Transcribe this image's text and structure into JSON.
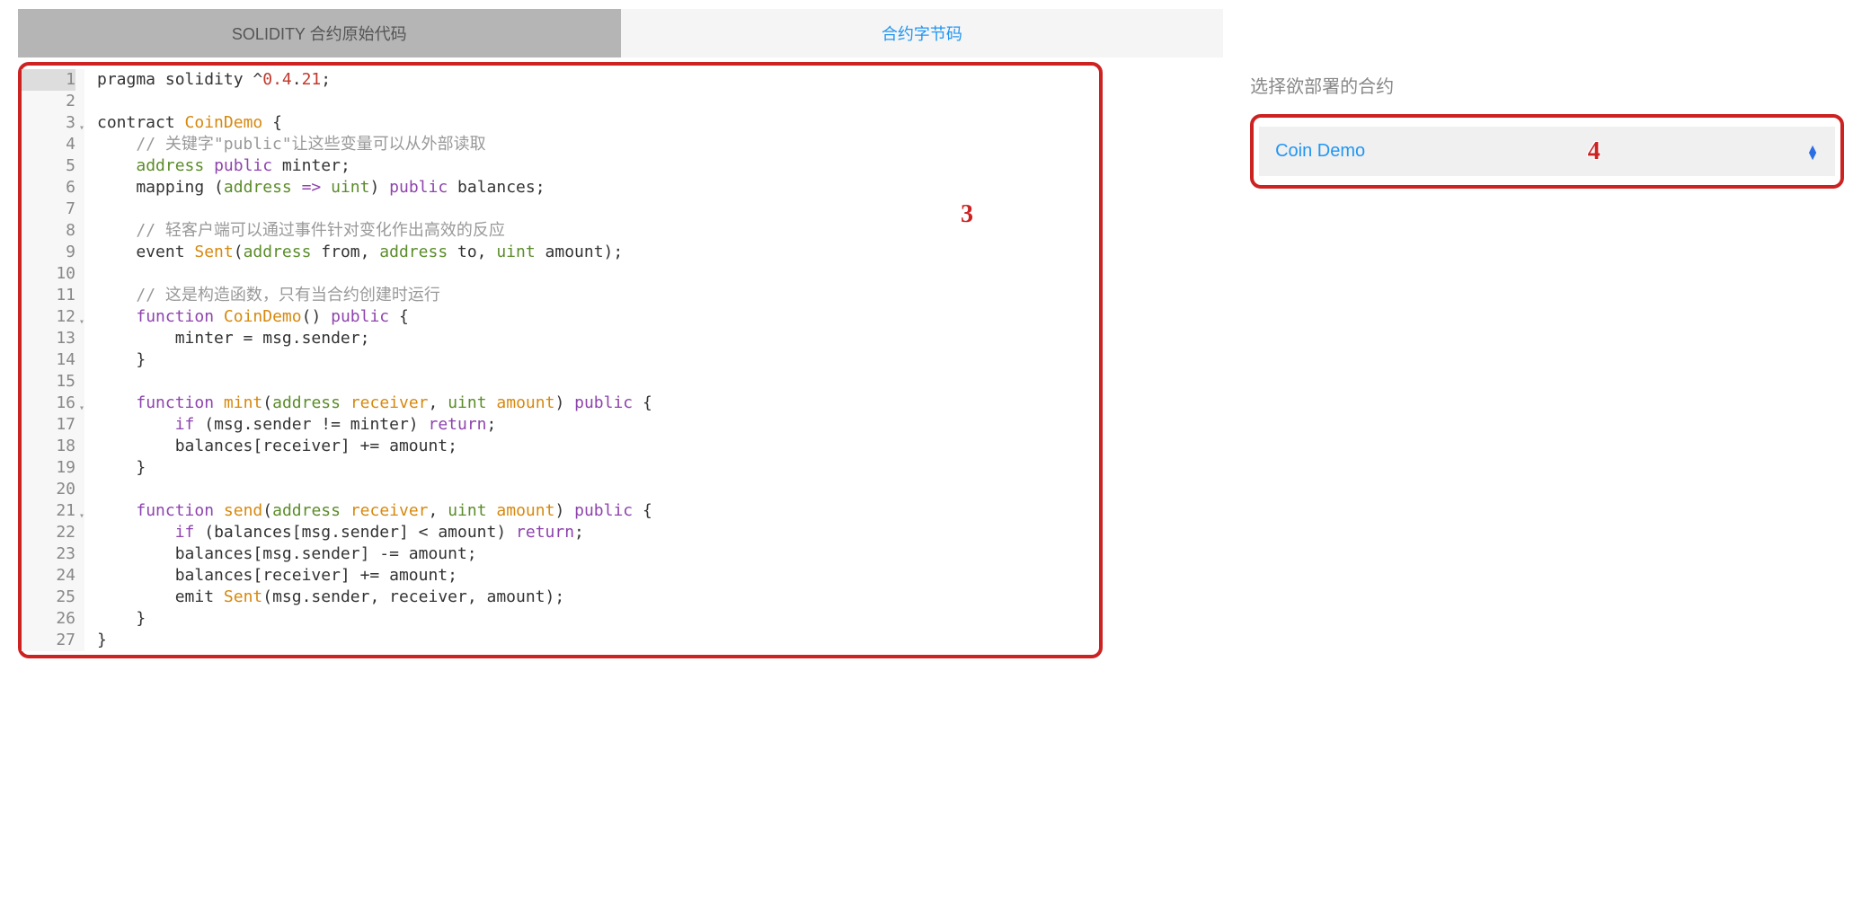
{
  "tabs": {
    "source": "SOLIDITY 合约原始代码",
    "bytecode": "合约字节码"
  },
  "callouts": {
    "editor": "3",
    "select": "4"
  },
  "sidebar": {
    "label": "选择欲部署的合约",
    "selected": "Coin Demo"
  },
  "editor": {
    "lines": [
      {
        "n": 1,
        "fold": false,
        "hl": true,
        "tokens": [
          [
            "",
            "pragma solidity ^"
          ],
          [
            "num",
            "0.4"
          ],
          [
            "",
            "."
          ],
          [
            "num",
            "21"
          ],
          [
            "",
            ";"
          ]
        ]
      },
      {
        "n": 2,
        "fold": false,
        "hl": false,
        "tokens": []
      },
      {
        "n": 3,
        "fold": true,
        "hl": false,
        "tokens": [
          [
            "",
            "contract "
          ],
          [
            "ident",
            "CoinDemo"
          ],
          [
            "",
            " {"
          ]
        ]
      },
      {
        "n": 4,
        "fold": false,
        "hl": false,
        "tokens": [
          [
            "",
            "    "
          ],
          [
            "comment",
            "// 关键字\"public\"让这些变量可以从外部读取"
          ]
        ]
      },
      {
        "n": 5,
        "fold": false,
        "hl": false,
        "tokens": [
          [
            "",
            "    "
          ],
          [
            "type",
            "address"
          ],
          [
            "",
            " "
          ],
          [
            "kw",
            "public"
          ],
          [
            "",
            " minter;"
          ]
        ]
      },
      {
        "n": 6,
        "fold": false,
        "hl": false,
        "tokens": [
          [
            "",
            "    mapping ("
          ],
          [
            "type",
            "address"
          ],
          [
            "",
            " "
          ],
          [
            "kw",
            "=>"
          ],
          [
            "",
            " "
          ],
          [
            "type",
            "uint"
          ],
          [
            "",
            ") "
          ],
          [
            "kw",
            "public"
          ],
          [
            "",
            " balances;"
          ]
        ]
      },
      {
        "n": 7,
        "fold": false,
        "hl": false,
        "tokens": []
      },
      {
        "n": 8,
        "fold": false,
        "hl": false,
        "tokens": [
          [
            "",
            "    "
          ],
          [
            "comment",
            "// 轻客户端可以通过事件针对变化作出高效的反应"
          ]
        ]
      },
      {
        "n": 9,
        "fold": false,
        "hl": false,
        "tokens": [
          [
            "",
            "    event "
          ],
          [
            "fn",
            "Sent"
          ],
          [
            "",
            "("
          ],
          [
            "type",
            "address"
          ],
          [
            "",
            " from, "
          ],
          [
            "type",
            "address"
          ],
          [
            "",
            " to, "
          ],
          [
            "type",
            "uint"
          ],
          [
            "",
            " amount);"
          ]
        ]
      },
      {
        "n": 10,
        "fold": false,
        "hl": false,
        "tokens": []
      },
      {
        "n": 11,
        "fold": false,
        "hl": false,
        "tokens": [
          [
            "",
            "    "
          ],
          [
            "comment",
            "// 这是构造函数，只有当合约创建时运行"
          ]
        ]
      },
      {
        "n": 12,
        "fold": true,
        "hl": false,
        "tokens": [
          [
            "",
            "    "
          ],
          [
            "kw",
            "function"
          ],
          [
            "",
            " "
          ],
          [
            "fn",
            "CoinDemo"
          ],
          [
            "",
            "() "
          ],
          [
            "kw",
            "public"
          ],
          [
            "",
            " {"
          ]
        ]
      },
      {
        "n": 13,
        "fold": false,
        "hl": false,
        "tokens": [
          [
            "",
            "        minter = msg.sender;"
          ]
        ]
      },
      {
        "n": 14,
        "fold": false,
        "hl": false,
        "tokens": [
          [
            "",
            "    }"
          ]
        ]
      },
      {
        "n": 15,
        "fold": false,
        "hl": false,
        "tokens": []
      },
      {
        "n": 16,
        "fold": true,
        "hl": false,
        "tokens": [
          [
            "",
            "    "
          ],
          [
            "kw",
            "function"
          ],
          [
            "",
            " "
          ],
          [
            "fn",
            "mint"
          ],
          [
            "",
            "("
          ],
          [
            "type",
            "address"
          ],
          [
            "",
            " "
          ],
          [
            "ident",
            "receiver"
          ],
          [
            "",
            ", "
          ],
          [
            "type",
            "uint"
          ],
          [
            "",
            " "
          ],
          [
            "ident",
            "amount"
          ],
          [
            "",
            ") "
          ],
          [
            "kw",
            "public"
          ],
          [
            "",
            " {"
          ]
        ]
      },
      {
        "n": 17,
        "fold": false,
        "hl": false,
        "tokens": [
          [
            "",
            "        "
          ],
          [
            "kw",
            "if"
          ],
          [
            "",
            " (msg.sender != minter) "
          ],
          [
            "kw",
            "return"
          ],
          [
            "",
            ";"
          ]
        ]
      },
      {
        "n": 18,
        "fold": false,
        "hl": false,
        "tokens": [
          [
            "",
            "        balances[receiver] += amount;"
          ]
        ]
      },
      {
        "n": 19,
        "fold": false,
        "hl": false,
        "tokens": [
          [
            "",
            "    }"
          ]
        ]
      },
      {
        "n": 20,
        "fold": false,
        "hl": false,
        "tokens": []
      },
      {
        "n": 21,
        "fold": true,
        "hl": false,
        "tokens": [
          [
            "",
            "    "
          ],
          [
            "kw",
            "function"
          ],
          [
            "",
            " "
          ],
          [
            "fn",
            "send"
          ],
          [
            "",
            "("
          ],
          [
            "type",
            "address"
          ],
          [
            "",
            " "
          ],
          [
            "ident",
            "receiver"
          ],
          [
            "",
            ", "
          ],
          [
            "type",
            "uint"
          ],
          [
            "",
            " "
          ],
          [
            "ident",
            "amount"
          ],
          [
            "",
            ") "
          ],
          [
            "kw",
            "public"
          ],
          [
            "",
            " {"
          ]
        ]
      },
      {
        "n": 22,
        "fold": false,
        "hl": false,
        "tokens": [
          [
            "",
            "        "
          ],
          [
            "kw",
            "if"
          ],
          [
            "",
            " (balances[msg.sender] < amount) "
          ],
          [
            "kw",
            "return"
          ],
          [
            "",
            ";"
          ]
        ]
      },
      {
        "n": 23,
        "fold": false,
        "hl": false,
        "tokens": [
          [
            "",
            "        balances[msg.sender] -= amount;"
          ]
        ]
      },
      {
        "n": 24,
        "fold": false,
        "hl": false,
        "tokens": [
          [
            "",
            "        balances[receiver] += amount;"
          ]
        ]
      },
      {
        "n": 25,
        "fold": false,
        "hl": false,
        "tokens": [
          [
            "",
            "        emit "
          ],
          [
            "fn",
            "Sent"
          ],
          [
            "",
            "(msg.sender, receiver, amount);"
          ]
        ]
      },
      {
        "n": 26,
        "fold": false,
        "hl": false,
        "tokens": [
          [
            "",
            "    }"
          ]
        ]
      },
      {
        "n": 27,
        "fold": false,
        "hl": false,
        "tokens": [
          [
            "",
            "}"
          ]
        ]
      }
    ]
  }
}
